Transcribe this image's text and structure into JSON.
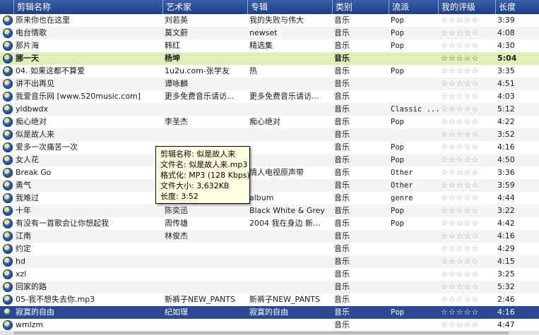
{
  "columns": [
    {
      "label": "剪辑名称"
    },
    {
      "label": "艺术家"
    },
    {
      "label": "专辑"
    },
    {
      "label": "类别"
    },
    {
      "label": "流派"
    },
    {
      "label": "我的评级"
    },
    {
      "label": "长度"
    }
  ],
  "rating_stars": "☆☆☆☆☆",
  "rows": [
    {
      "title": "原来你也在这里",
      "artist": "刘若英",
      "album": "我的失败与伟大",
      "category": "音乐",
      "genre": "Pop",
      "length": "3:39"
    },
    {
      "title": "电台情歌",
      "artist": "莫文蔚",
      "album": "newset",
      "category": "音乐",
      "genre": "Pop",
      "length": "4:08"
    },
    {
      "title": "那片海",
      "artist": "韩红",
      "album": "精选集",
      "category": "音乐",
      "genre": "Pop",
      "length": "4:30"
    },
    {
      "title": "挪一天",
      "artist": "杨坤",
      "album": "",
      "category": "音乐",
      "genre": "",
      "length": "5:04"
    },
    {
      "title": "04. 如果这都不算爱",
      "artist": "1u2u.com-张学友",
      "album": "热",
      "category": "音乐",
      "genre": "Pop",
      "length": "3:35"
    },
    {
      "title": "讲不出再见",
      "artist": "谭咏麟",
      "album": "",
      "category": "音乐",
      "genre": "",
      "length": "4:51"
    },
    {
      "title": "我爱音乐网 [www.520music.com]",
      "artist": "更多免费音乐请访...",
      "album": "更多免费音乐请访...",
      "category": "音乐",
      "genre": "",
      "length": "4:03"
    },
    {
      "title": "yldbwdx",
      "artist": "",
      "album": "",
      "category": "音乐",
      "genre": "Classic ...",
      "length": "5:12"
    },
    {
      "title": "痴心绝对",
      "artist": "李圣杰",
      "album": "痴心绝对",
      "category": "音乐",
      "genre": "Pop",
      "length": "4:22"
    },
    {
      "title": "似是故人来",
      "artist": "",
      "album": "",
      "category": "音乐",
      "genre": "",
      "length": "3:52"
    },
    {
      "title": "爱多一次痛苦一次",
      "artist": "",
      "album": "",
      "category": "音乐",
      "genre": "Pop",
      "length": "4:16"
    },
    {
      "title": "女人花",
      "artist": "",
      "album": "",
      "category": "音乐",
      "genre": "Pop",
      "length": "4:50"
    },
    {
      "title": "Break Go",
      "artist": "",
      "album": "情人电视原声带",
      "category": "音乐",
      "genre": "Other",
      "length": "3:36"
    },
    {
      "title": "勇气",
      "artist": "",
      "album": "",
      "category": "音乐",
      "genre": "Other",
      "length": "3:59"
    },
    {
      "title": "我难过",
      "artist": "",
      "album": "album",
      "category": "音乐",
      "genre": "genre",
      "length": "4:44"
    },
    {
      "title": "十年",
      "artist": "陈奕迅",
      "album": "Black White & Grey",
      "category": "音乐",
      "genre": "Pop",
      "length": "3:22"
    },
    {
      "title": "有没有一首歌会让你想起我",
      "artist": "周传雄",
      "album": "2004 我在身边 新...",
      "category": "音乐",
      "genre": "Pop",
      "length": "4:42"
    },
    {
      "title": "江南",
      "artist": "林俊杰",
      "album": "",
      "category": "音乐",
      "genre": "",
      "length": "4:16"
    },
    {
      "title": "约定",
      "artist": "",
      "album": "",
      "category": "音乐",
      "genre": "",
      "length": "4:29"
    },
    {
      "title": "hd",
      "artist": "",
      "album": "",
      "category": "音乐",
      "genre": "",
      "length": "4:15"
    },
    {
      "title": "xzl",
      "artist": "",
      "album": "",
      "category": "音乐",
      "genre": "",
      "length": "3:25"
    },
    {
      "title": "回家的路",
      "artist": "",
      "album": "",
      "category": "音乐",
      "genre": "",
      "length": "5:32"
    },
    {
      "title": "05-我不想失去你.mp3",
      "artist": "新裤子NEW_PANTS",
      "album": "新裤子NEW_PANTS",
      "category": "音乐",
      "genre": "",
      "length": "2:46"
    },
    {
      "title": "寂寞的自由",
      "artist": "纪如璟",
      "album": "寂寞的自由",
      "category": "音乐",
      "genre": "Pop",
      "length": "4:16"
    },
    {
      "title": "wmlzm",
      "artist": "",
      "album": "",
      "category": "音乐",
      "genre": "",
      "length": "4:47"
    }
  ],
  "tooltip": {
    "line1": "剪辑名称:  似是故人来",
    "line2": "文件名:  似是故人来.mp3",
    "line3": "格式化:  MP3 (128 Kbps)",
    "line4": "文件大小:  3,632KB",
    "line5": "长度:  3:52"
  }
}
